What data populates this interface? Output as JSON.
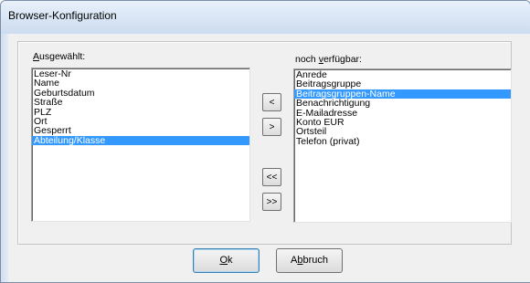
{
  "window": {
    "title": "Browser-Konfiguration"
  },
  "selected_list": {
    "label_prefix": "",
    "label_mnemonic": "A",
    "label_rest": "usgewählt:",
    "items": [
      "Leser-Nr",
      "Name",
      "Geburtsdatum",
      "Straße",
      "PLZ",
      "Ort",
      "Gesperrt",
      "Abteilung/Klasse"
    ],
    "selected_index": 7
  },
  "available_list": {
    "label_prefix": "noch ",
    "label_mnemonic": "v",
    "label_rest": "erfügbar:",
    "items": [
      "Anrede",
      "Beitragsgruppe",
      "Beitragsgruppen-Name",
      "Benachrichtigung",
      "E-Mailadresse",
      "Konto EUR",
      "Ortsteil",
      "Telefon (privat)"
    ],
    "selected_index": 2
  },
  "move_buttons": {
    "add": "<",
    "remove": ">",
    "add_all": "<<",
    "remove_all": ">>"
  },
  "footer": {
    "ok_mnemonic": "O",
    "ok_rest": "k",
    "cancel_prefix": "A",
    "cancel_mnemonic": "b",
    "cancel_rest": "bruch"
  },
  "colors": {
    "selection": "#3399ff",
    "title_bar": "#dbe7f6"
  }
}
